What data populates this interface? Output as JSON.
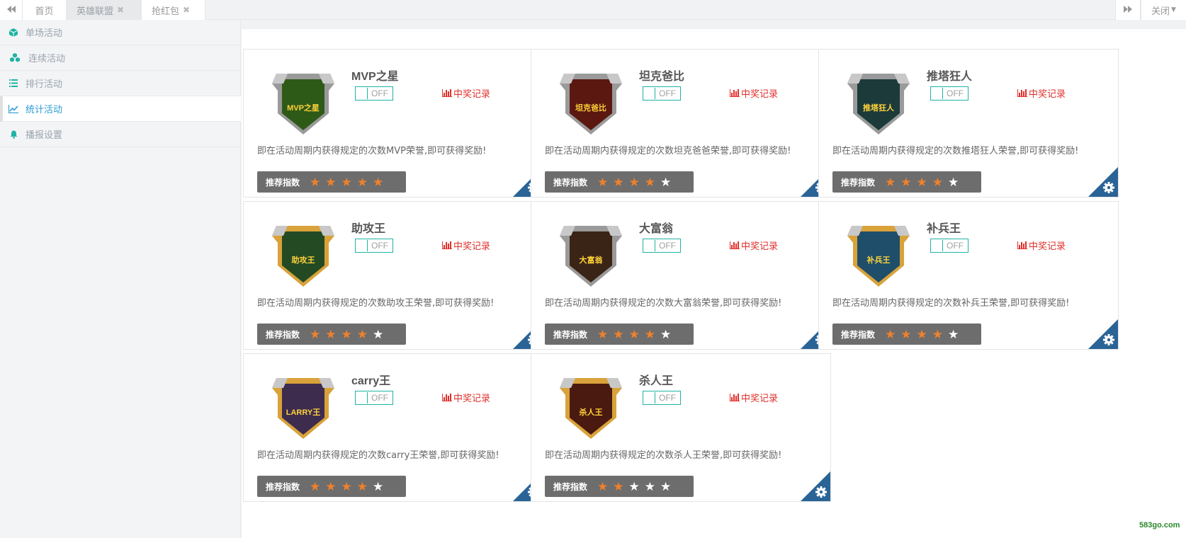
{
  "topbar": {
    "prev_icon": "double-left-arrow-icon",
    "next_icon": "double-right-arrow-icon",
    "tabs": [
      {
        "label": "首页",
        "closable": false
      },
      {
        "label": "英雄联盟",
        "closable": true
      },
      {
        "label": "抢红包",
        "closable": true
      }
    ],
    "close_label": "关闭",
    "close_icon": "caret-down-icon"
  },
  "sidebar": {
    "items": [
      {
        "label": "单场活动",
        "icon": "cube-icon",
        "active": false
      },
      {
        "label": "连续活动",
        "icon": "cubes-icon",
        "active": false
      },
      {
        "label": "排行活动",
        "icon": "list-icon",
        "active": false
      },
      {
        "label": "统计活动",
        "icon": "line-chart-icon",
        "active": true
      },
      {
        "label": "播报设置",
        "icon": "bell-icon",
        "active": false
      }
    ]
  },
  "cards": [
    {
      "title": "MVP之星",
      "toggle": "OFF",
      "record": "中奖记录",
      "desc": "即在活动周期内获得规定的次数MVP荣誉,即可获得奖励!",
      "rating_label": "推荐指数",
      "stars": 5,
      "badge_text": "MVP之星",
      "badge_color": "#2e5a17",
      "frame_color": "#9a9a9a"
    },
    {
      "title": "坦克爸比",
      "toggle": "OFF",
      "record": "中奖记录",
      "desc": "即在活动周期内获得规定的次数坦克爸爸荣誉,即可获得奖励!",
      "rating_label": "推荐指数",
      "stars": 4,
      "badge_text": "坦克爸比",
      "badge_color": "#5a1810",
      "frame_color": "#9a9a9a"
    },
    {
      "title": "推塔狂人",
      "toggle": "OFF",
      "record": "中奖记录",
      "desc": "即在活动周期内获得规定的次数推塔狂人荣誉,即可获得奖励!",
      "rating_label": "推荐指数",
      "stars": 4,
      "badge_text": "推塔狂人",
      "badge_color": "#1c3a3a",
      "frame_color": "#9a9a9a"
    },
    {
      "title": "助攻王",
      "toggle": "OFF",
      "record": "中奖记录",
      "desc": "即在活动周期内获得规定的次数助攻王荣誉,即可获得奖励!",
      "rating_label": "推荐指数",
      "stars": 4,
      "badge_text": "助攻王",
      "badge_color": "#244a24",
      "frame_color": "#d9a23a"
    },
    {
      "title": "大富翁",
      "toggle": "OFF",
      "record": "中奖记录",
      "desc": "即在活动周期内获得规定的次数大富翁荣誉,即可获得奖励!",
      "rating_label": "推荐指数",
      "stars": 4,
      "badge_text": "大富翁",
      "badge_color": "#3a2416",
      "frame_color": "#9a9a9a"
    },
    {
      "title": "补兵王",
      "toggle": "OFF",
      "record": "中奖记录",
      "desc": "即在活动周期内获得规定的次数补兵王荣誉,即可获得奖励!",
      "rating_label": "推荐指数",
      "stars": 4,
      "badge_text": "补兵王",
      "badge_color": "#1e4e6a",
      "frame_color": "#d9a23a"
    },
    {
      "title": "carry王",
      "toggle": "OFF",
      "record": "中奖记录",
      "desc": "即在活动周期内获得规定的次数carry王荣誉,即可获得奖励!",
      "rating_label": "推荐指数",
      "stars": 4,
      "badge_text": "LARRY王",
      "badge_color": "#3d2c4e",
      "frame_color": "#d9a23a"
    },
    {
      "title": "杀人王",
      "toggle": "OFF",
      "record": "中奖记录",
      "desc": "即在活动周期内获得规定的次数杀人王荣誉,即可获得奖励!",
      "rating_label": "推荐指数",
      "stars": 2,
      "badge_text": "杀人王",
      "badge_color": "#4a1a10",
      "frame_color": "#d9a23a"
    }
  ],
  "colors": {
    "accent": "#1fb3a4",
    "link_active": "#2c9bd3",
    "record_red": "#e0302b",
    "star_on": "#f0812b",
    "corner_blue": "#2a6496"
  },
  "watermark": "583go.com"
}
